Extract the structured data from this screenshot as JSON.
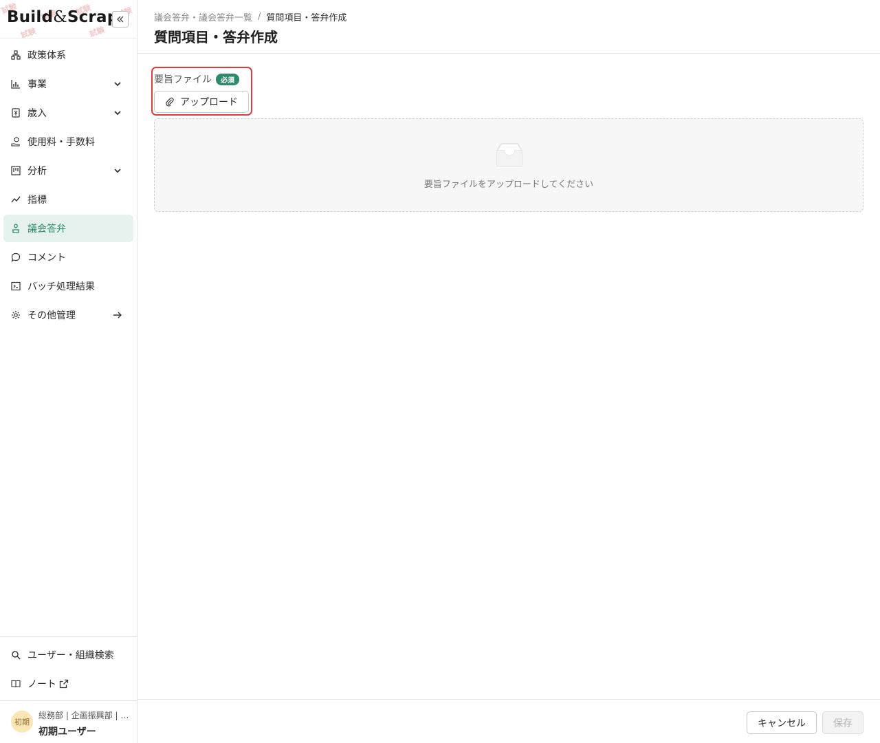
{
  "brand": {
    "logo_build": "Build",
    "logo_amp": "&",
    "logo_scrap": "Scrap",
    "collapse_icon": "double-chevron-left-icon"
  },
  "sidebar": {
    "items": [
      {
        "label": "政策体系",
        "icon": "hierarchy-icon",
        "caret": ""
      },
      {
        "label": "事業",
        "icon": "bar-chart-icon",
        "caret": "chevron-down"
      },
      {
        "label": "歳入",
        "icon": "yen-doc-icon",
        "caret": "chevron-down"
      },
      {
        "label": "使用料・手数料",
        "icon": "hand-coin-icon",
        "caret": ""
      },
      {
        "label": "分析",
        "icon": "board-icon",
        "caret": "chevron-down"
      },
      {
        "label": "指標",
        "icon": "trend-icon",
        "caret": ""
      },
      {
        "label": "議会答弁",
        "icon": "podium-icon",
        "caret": "",
        "active": true
      },
      {
        "label": "コメント",
        "icon": "comment-icon",
        "caret": ""
      },
      {
        "label": "バッチ処理結果",
        "icon": "terminal-icon",
        "caret": ""
      },
      {
        "label": "その他管理",
        "icon": "gear-icon",
        "caret": "arrow-right"
      }
    ],
    "bottom_items": [
      {
        "label": "ユーザー・組織検索",
        "icon": "search-icon"
      },
      {
        "label": "ノート",
        "icon": "book-icon"
      }
    ],
    "user": {
      "avatar_text": "初期",
      "org": "総務部 | 企画振興部 | …",
      "name": "初期ユーザー"
    }
  },
  "header": {
    "breadcrumb": [
      "議会答弁・議会答弁一覧",
      "/",
      "質問項目・答弁作成"
    ],
    "title": "質問項目・答弁作成"
  },
  "main": {
    "field_label": "要旨ファイル",
    "required_badge": "必須",
    "upload_label": "アップロード",
    "empty_text": "要旨ファイルをアップロードしてください"
  },
  "footer": {
    "cancel_label": "キャンセル",
    "save_label": "保存"
  },
  "colors": {
    "accent": "#2e8a6b",
    "active_bg": "#e5f2ee",
    "highlight": "#e23a3a"
  }
}
